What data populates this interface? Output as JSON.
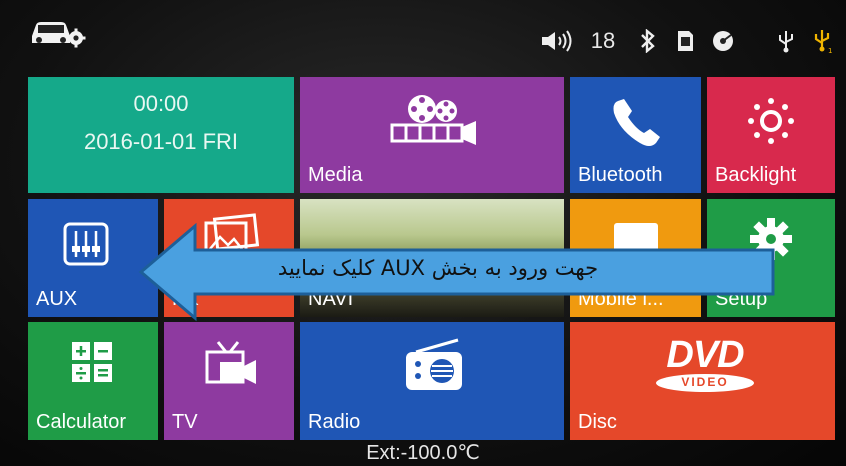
{
  "status_bar": {
    "volume_value": "18",
    "icons": [
      "car-settings-icon",
      "volume-icon",
      "bluetooth-icon",
      "sd-card-icon",
      "disc-icon",
      "usb-icon",
      "usb-active-icon"
    ],
    "usb_active_color": "#f0b400"
  },
  "tiles": {
    "clock": {
      "time": "00:00",
      "date": "2016-01-01 FRI",
      "color": "#15a98a"
    },
    "media": {
      "label": "Media",
      "color": "#8e3aa0"
    },
    "bluetooth": {
      "label": "Bluetooth",
      "color": "#1f56b5"
    },
    "backlight": {
      "label": "Backlight",
      "color": "#d8294d"
    },
    "aux": {
      "label": "AUX",
      "color": "#1f56b5"
    },
    "pic": {
      "label": "PK",
      "color": "#e5482a"
    },
    "navi": {
      "label": "NAVI"
    },
    "mobile": {
      "label": "Mobile l...",
      "color": "#f09a0f"
    },
    "setup": {
      "label": "Setup",
      "color": "#1f9c47"
    },
    "calculator": {
      "label": "Calculator",
      "color": "#1f9c47"
    },
    "tv": {
      "label": "TV",
      "color": "#8e3aa0"
    },
    "radio": {
      "label": "Radio",
      "color": "#1f56b5"
    },
    "disc": {
      "label": "Disc",
      "color": "#e5482a",
      "logo_main": "DVD",
      "logo_sub": "VIDEO"
    }
  },
  "footer": {
    "ext_temp": "Ext:-100.0℃"
  },
  "callout": {
    "text": "جهت ورود به بخش  AUX کلیک نمایید",
    "color": "#4aa0e0"
  }
}
